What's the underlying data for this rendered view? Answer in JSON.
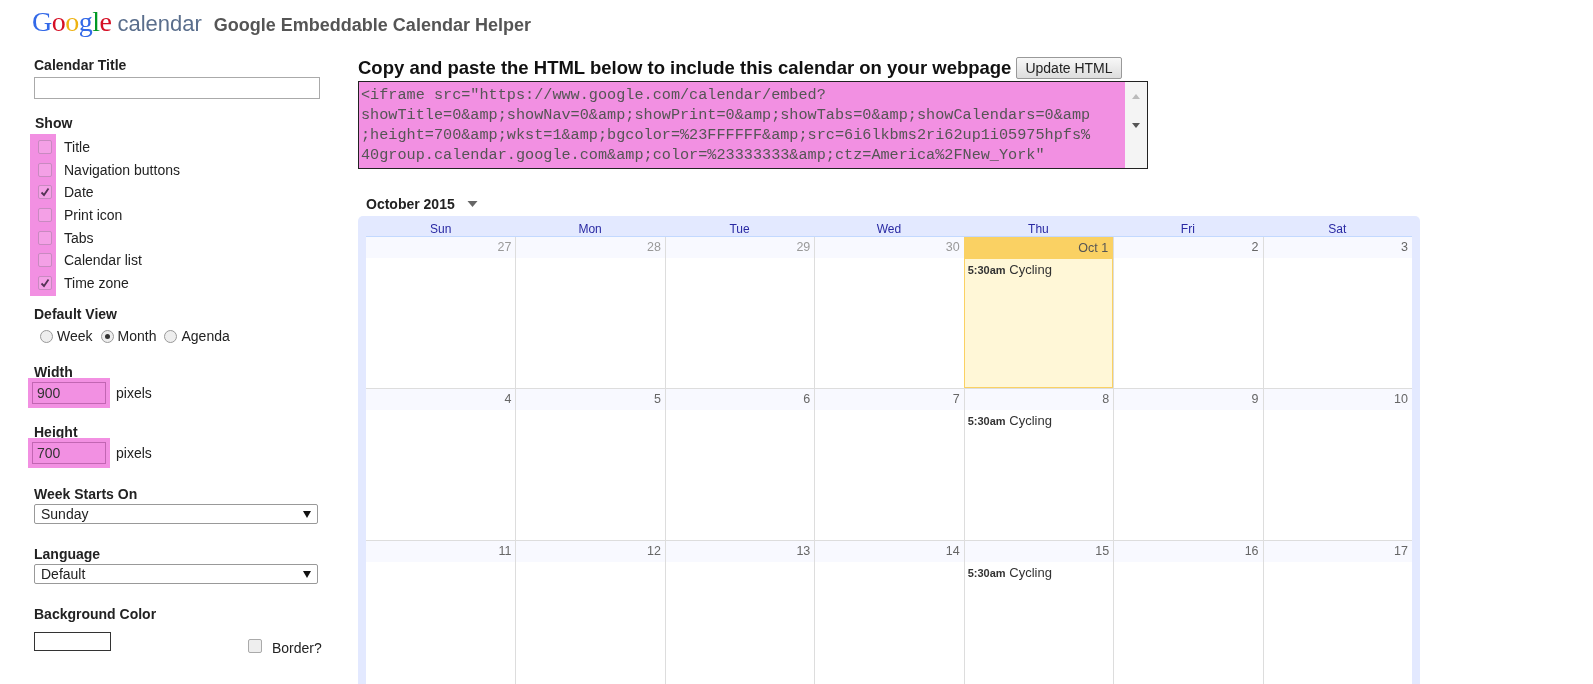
{
  "header": {
    "logo_word": "Google",
    "logo_product": "calendar",
    "title": "Google Embeddable Calendar Helper"
  },
  "settings": {
    "calendar_title": {
      "label": "Calendar Title"
    },
    "show": {
      "label": "Show",
      "highlighted": true,
      "options": [
        {
          "label": "Title",
          "checked": false
        },
        {
          "label": "Navigation buttons",
          "checked": false
        },
        {
          "label": "Date",
          "checked": true
        },
        {
          "label": "Print icon",
          "checked": false
        },
        {
          "label": "Tabs",
          "checked": false
        },
        {
          "label": "Calendar list",
          "checked": false
        },
        {
          "label": "Time zone",
          "checked": true
        }
      ]
    },
    "default_view": {
      "label": "Default View",
      "options": [
        {
          "label": "Week",
          "selected": false
        },
        {
          "label": "Month",
          "selected": true
        },
        {
          "label": "Agenda",
          "selected": false
        }
      ]
    },
    "width": {
      "label": "Width",
      "value": "900",
      "unit": "pixels",
      "highlighted": true
    },
    "height": {
      "label": "Height",
      "value": "700",
      "unit": "pixels",
      "highlighted": true
    },
    "week_starts_on": {
      "label": "Week Starts On",
      "value": "Sunday"
    },
    "language": {
      "label": "Language",
      "value": "Default"
    },
    "background_color": {
      "label": "Background Color",
      "border_label": "Border?",
      "border_checked": false
    }
  },
  "embed": {
    "heading": "Copy and paste the HTML below to include this calendar on your webpage",
    "button": "Update HTML",
    "highlighted": true,
    "code_lines": [
      "<iframe src=\"https://www.google.com/calendar/embed?",
      "showTitle=0&amp;showNav=0&amp;showPrint=0&amp;showTabs=0&amp;showCalendars=0&amp",
      ";height=700&amp;wkst=1&amp;bgcolor=%23FFFFFF&amp;src=6i6lkbms2ri62up1i05975hpfs%",
      "40group.calendar.google.com&amp;color=%23333333&amp;ctz=America%2FNew_York\""
    ]
  },
  "calendar": {
    "month_label": "October 2015",
    "weekdays": [
      "Sun",
      "Mon",
      "Tue",
      "Wed",
      "Thu",
      "Fri",
      "Sat"
    ],
    "weeks": [
      [
        {
          "day": "27",
          "other_month": true,
          "today": false
        },
        {
          "day": "28",
          "other_month": true,
          "today": false
        },
        {
          "day": "29",
          "other_month": true,
          "today": false
        },
        {
          "day": "30",
          "other_month": true,
          "today": false
        },
        {
          "day": "Oct 1",
          "other_month": false,
          "today": true,
          "events": [
            {
              "time": "5:30am",
              "title": "Cycling"
            }
          ]
        },
        {
          "day": "2",
          "other_month": false,
          "today": false
        },
        {
          "day": "3",
          "other_month": false,
          "today": false
        }
      ],
      [
        {
          "day": "4",
          "other_month": false,
          "today": false
        },
        {
          "day": "5",
          "other_month": false,
          "today": false
        },
        {
          "day": "6",
          "other_month": false,
          "today": false
        },
        {
          "day": "7",
          "other_month": false,
          "today": false
        },
        {
          "day": "8",
          "other_month": false,
          "today": false,
          "events": [
            {
              "time": "5:30am",
              "title": "Cycling"
            }
          ]
        },
        {
          "day": "9",
          "other_month": false,
          "today": false
        },
        {
          "day": "10",
          "other_month": false,
          "today": false
        }
      ],
      [
        {
          "day": "11",
          "other_month": false,
          "today": false
        },
        {
          "day": "12",
          "other_month": false,
          "today": false
        },
        {
          "day": "13",
          "other_month": false,
          "today": false
        },
        {
          "day": "14",
          "other_month": false,
          "today": false
        },
        {
          "day": "15",
          "other_month": false,
          "today": false,
          "events": [
            {
              "time": "5:30am",
              "title": "Cycling"
            }
          ]
        },
        {
          "day": "16",
          "other_month": false,
          "today": false
        },
        {
          "day": "17",
          "other_month": false,
          "today": false
        }
      ]
    ]
  }
}
